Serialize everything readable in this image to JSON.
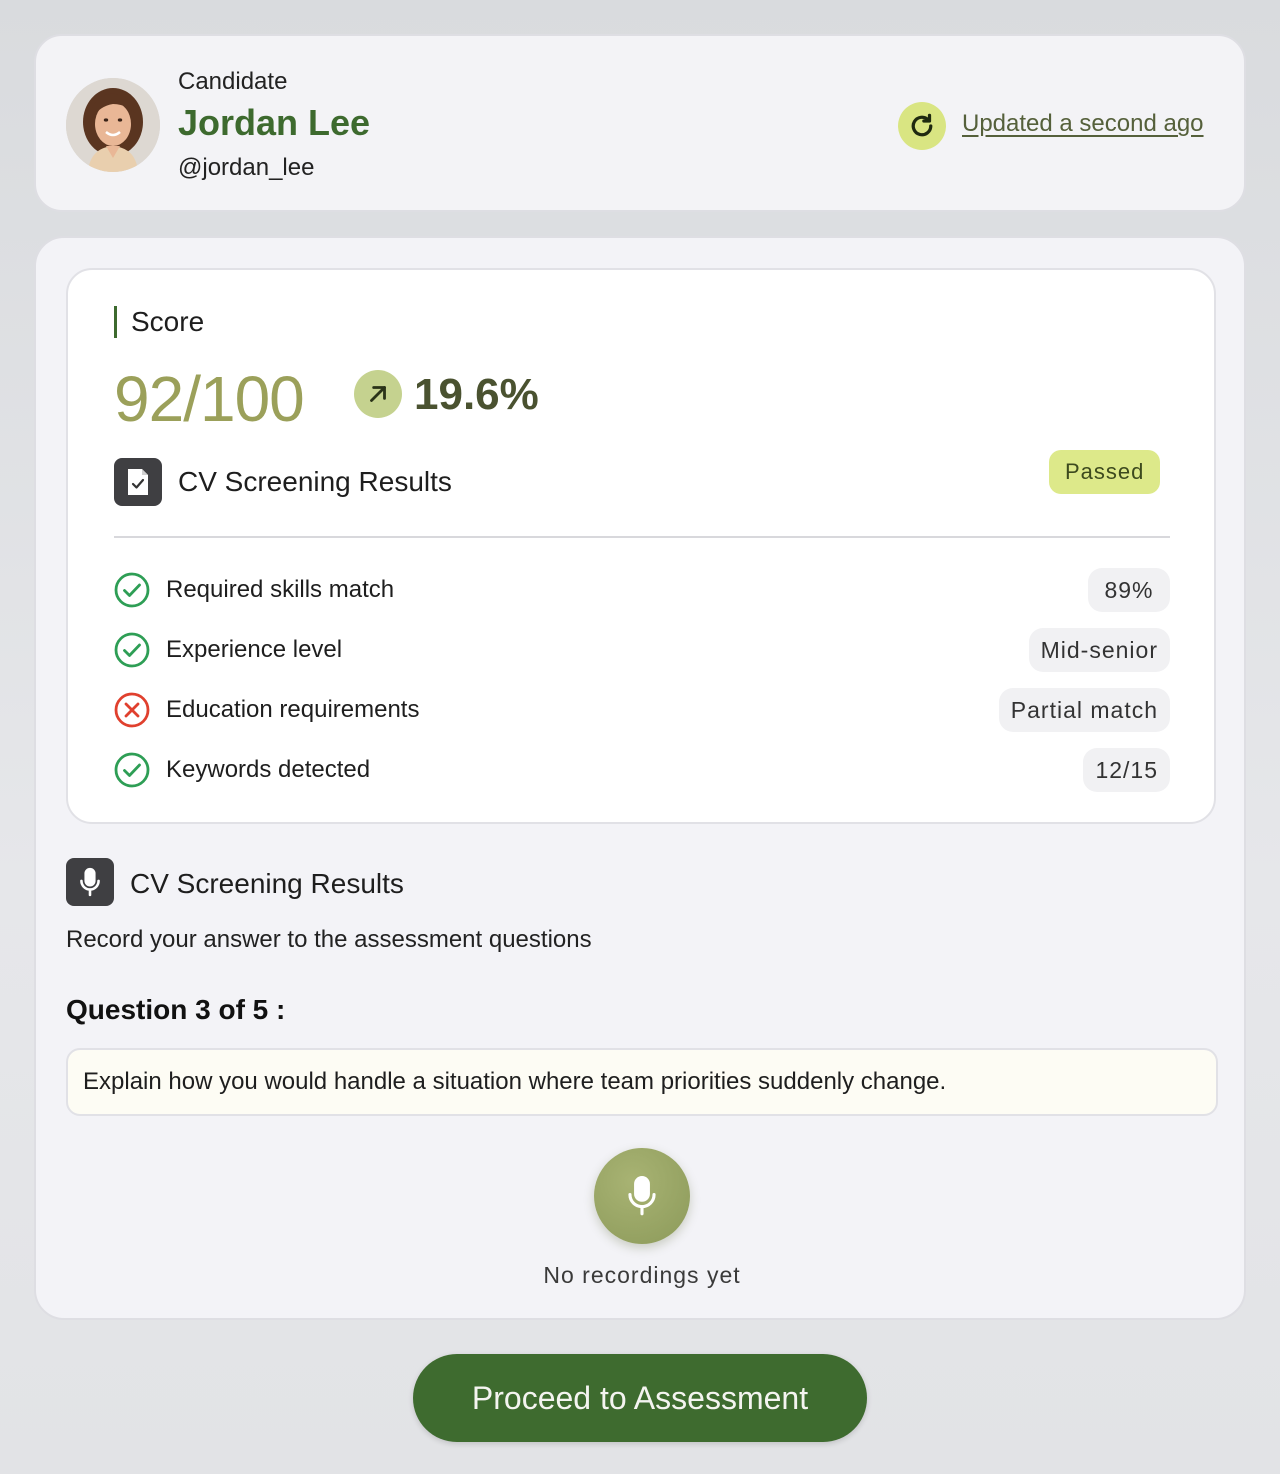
{
  "candidate": {
    "label": "Candidate",
    "name": "Jordan Lee",
    "handle": "@jordan_lee",
    "updated": "Updated a second ago"
  },
  "score": {
    "label": "Score",
    "value": "92/100",
    "trend": "19.6%"
  },
  "cv_screening": {
    "title": "CV Screening Results",
    "status": "Passed",
    "criteria": [
      {
        "label": "Required skills match",
        "value": "89%",
        "status": "pass"
      },
      {
        "label": "Experience level",
        "value": "Mid-senior",
        "status": "pass"
      },
      {
        "label": "Education requirements",
        "value": "Partial match",
        "status": "fail"
      },
      {
        "label": "Keywords detected",
        "value": "12/15",
        "status": "pass"
      }
    ]
  },
  "recording": {
    "title": "CV Screening Results",
    "subtitle": "Record your answer to the assessment questions",
    "question_label": "Question 3 of 5 :",
    "question_text": "Explain how you would handle a situation where team priorities suddenly change.",
    "empty_state": "No recordings yet"
  },
  "actions": {
    "proceed": "Proceed to Assessment"
  },
  "colors": {
    "brand_green": "#3e6b2f",
    "accent_lime": "#dde98a",
    "pass": "#2e9e55",
    "fail": "#e0402e"
  }
}
